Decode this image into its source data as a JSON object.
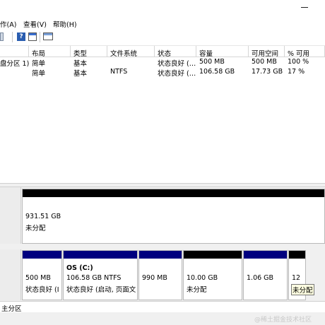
{
  "menu": {
    "action": "作(A)",
    "view": "查看(V)",
    "help": "帮助(H)"
  },
  "toolbar": {
    "icons": [
      "back-icon",
      "help-icon",
      "properties-icon",
      "console-icon"
    ]
  },
  "volume_table": {
    "columns": [
      "布局",
      "类型",
      "文件系统",
      "状态",
      "容量",
      "可用空间",
      "% 可用"
    ],
    "rows": [
      {
        "volume": "盘分区 1)",
        "layout": "简单",
        "type": "基本",
        "fs": "",
        "status": "状态良好 (…",
        "capacity": "500 MB",
        "free": "500 MB",
        "pct": "100 %"
      },
      {
        "volume": "",
        "layout": "简单",
        "type": "基本",
        "fs": "NTFS",
        "status": "状态良好 (…",
        "capacity": "106.58 GB",
        "free": "17.73 GB",
        "pct": "17 %"
      }
    ]
  },
  "disk0": {
    "size": "931.51 GB",
    "status": "未分配"
  },
  "disk1": {
    "partitions": [
      {
        "name": "",
        "size": "500 MB",
        "status": "状态良好 (I"
      },
      {
        "name": "OS  (C:)",
        "size": "106.58 GB NTFS",
        "status": "状态良好 (启动, 页面文"
      },
      {
        "name": "",
        "size": "990 MB",
        "status": ""
      },
      {
        "name": "",
        "size": "10.00 GB",
        "status": "未分配"
      },
      {
        "name": "",
        "size": "1.06 GB",
        "status": ""
      },
      {
        "name": "",
        "size": "12",
        "status": "未分配"
      }
    ]
  },
  "legend": {
    "primary": "主分区"
  },
  "watermark": "@稀土掘金技术社区",
  "colors": {
    "primary_partition": "#00007f",
    "unallocated": "#000000"
  }
}
